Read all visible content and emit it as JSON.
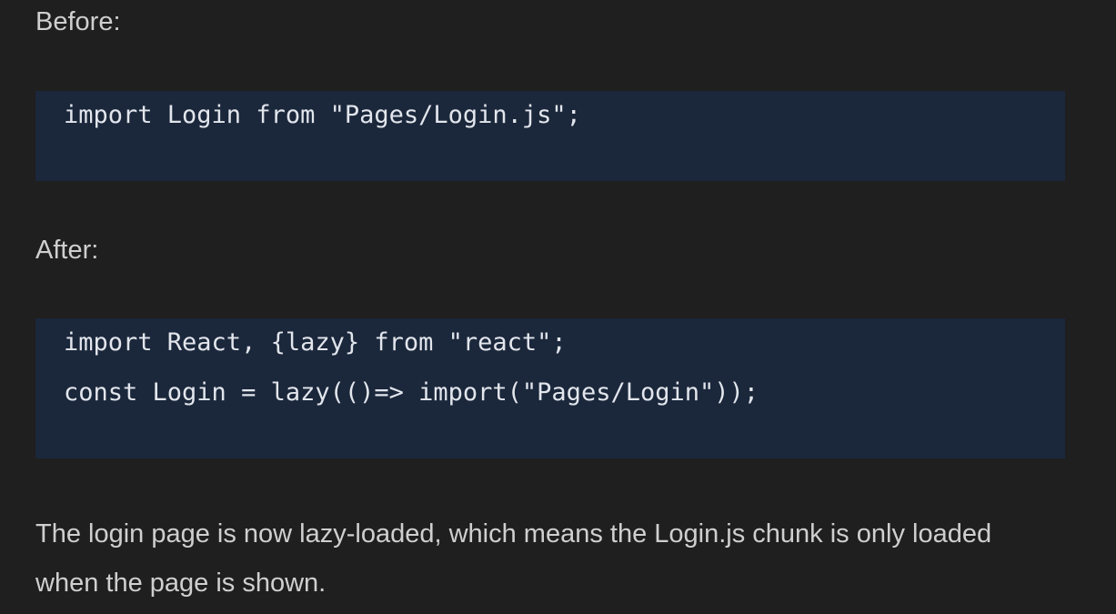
{
  "before": {
    "label": "Before:",
    "code": [
      "import Login from \"Pages/Login.js\";"
    ]
  },
  "after": {
    "label": "After:",
    "code": [
      "import React, {lazy} from \"react\";",
      "const Login = lazy(()=> import(\"Pages/Login\"));"
    ]
  },
  "paragraph": {
    "line_1": "The login page is now lazy-loaded, which means the Login.js chunk is only loaded",
    "line_2": "when the page is shown."
  },
  "colors": {
    "page_background": "#1f1f1f",
    "code_background": "#1b273b",
    "text": "#cfcfcf",
    "code_text": "#e2e6ec"
  }
}
